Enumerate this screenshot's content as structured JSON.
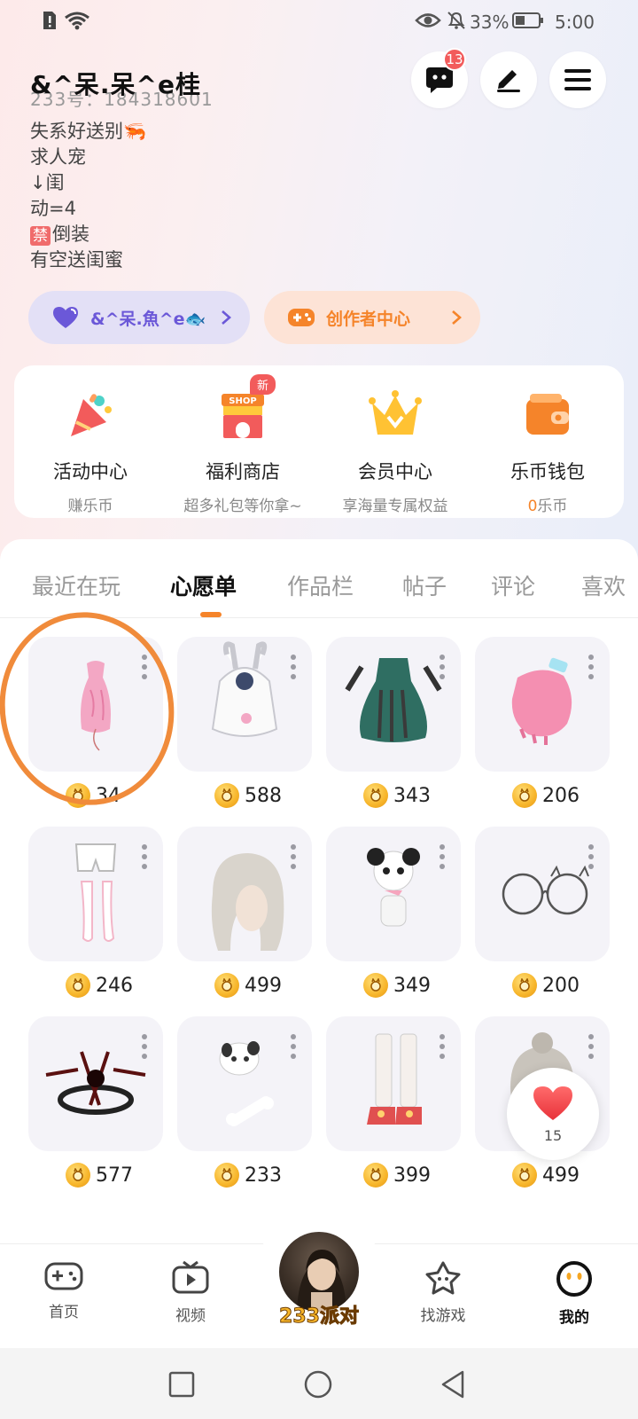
{
  "status_bar": {
    "battery_percent": "33%",
    "time": "5:00"
  },
  "profile": {
    "name": "&^呆.呆^e桂",
    "id_line": "233号：184318601",
    "bio": [
      "失系好送别🦐",
      "求人宠",
      "↓闺",
      "动=4",
      "倒装",
      "有空送闺蜜"
    ],
    "ban_badge": "禁"
  },
  "header": {
    "message_badge": "13"
  },
  "pills": {
    "companion_label": "&^呆.魚^e🐟",
    "creator_label": "创作者中心"
  },
  "quick_links": [
    {
      "title": "活动中心",
      "subtitle": "赚乐币"
    },
    {
      "title": "福利商店",
      "subtitle": "超多礼包等你拿~",
      "tag": "新"
    },
    {
      "title": "会员中心",
      "subtitle": "享海量专属权益"
    },
    {
      "title": "乐币钱包",
      "subtitle_value": "0",
      "subtitle_unit": "乐币"
    }
  ],
  "tabs": [
    "最近在玩",
    "心愿单",
    "作品栏",
    "帖子",
    "评论",
    "喜欢"
  ],
  "active_tab": "心愿单",
  "wishlist": [
    {
      "icon": "pink-dress-item",
      "price": "34"
    },
    {
      "icon": "bunny-hoodie-item",
      "price": "588"
    },
    {
      "icon": "dark-gothic-dress-item",
      "price": "343"
    },
    {
      "icon": "pink-paw-glove-item",
      "price": "206"
    },
    {
      "icon": "shorts-stockings-item",
      "price": "246"
    },
    {
      "icon": "silver-hair-item",
      "price": "499"
    },
    {
      "icon": "panda-plush-item",
      "price": "349"
    },
    {
      "icon": "round-glasses-item",
      "price": "200"
    },
    {
      "icon": "dark-halo-item",
      "price": "577"
    },
    {
      "icon": "puppy-bone-item",
      "price": "233"
    },
    {
      "icon": "white-boots-item",
      "price": "399"
    },
    {
      "icon": "silver-hair-bun-item",
      "price": "499"
    }
  ],
  "floating_like": {
    "count": "15"
  },
  "bottom_nav": {
    "home": "首页",
    "video": "视频",
    "center": "233派对",
    "find_game": "找游戏",
    "mine": "我的"
  },
  "colors": {
    "accent": "#f5842a",
    "badge_red": "#f25b5b",
    "companion_pill_bg": "#e3e0f6",
    "creator_pill_bg": "#fde3d6"
  }
}
